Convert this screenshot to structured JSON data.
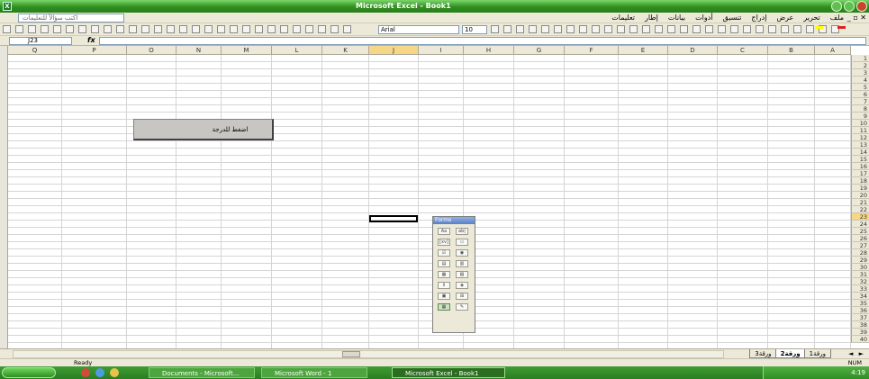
{
  "window": {
    "title": "Microsoft Excel - Book1"
  },
  "menubar": {
    "help_placeholder": "اكتب سؤالاً للتعليمات",
    "items": [
      "ملف",
      "تحرير",
      "عرض",
      "إدراج",
      "تنسيق",
      "أدوات",
      "بيانات",
      "إطار",
      "تعليمات"
    ]
  },
  "toolbar": {
    "font": "Arial",
    "size": "10"
  },
  "formula_bar": {
    "name_box": "J23",
    "fx": "fx",
    "formula": ""
  },
  "grid": {
    "column_headers": [
      "Q",
      "P",
      "O",
      "N",
      "M",
      "L",
      "K",
      "J",
      "I",
      "H",
      "G",
      "F",
      "E",
      "D",
      "C",
      "B",
      "A"
    ],
    "active_column": "J",
    "row_headers": [
      "1",
      "2",
      "3",
      "4",
      "5",
      "6",
      "7",
      "8",
      "9",
      "10",
      "11",
      "12",
      "13",
      "14",
      "15",
      "16",
      "17",
      "18",
      "19",
      "20",
      "21",
      "22",
      "23",
      "24",
      "25",
      "26",
      "27",
      "28",
      "29",
      "30",
      "31",
      "32",
      "33",
      "34",
      "35",
      "36",
      "37",
      "38",
      "39",
      "40"
    ],
    "active_row": "23"
  },
  "sheet_button": {
    "label": "اضغط للدرجة"
  },
  "forms_toolbar": {
    "title": "Forms",
    "tools": [
      "Aa",
      "ab|",
      "[xv]",
      "▭",
      "☑",
      "◉",
      "▤",
      "▥",
      "▦",
      "▧",
      "⇕",
      "◈",
      "▣",
      "⊞",
      "▦",
      "✎"
    ]
  },
  "sheet_tabs": {
    "tabs": [
      "ورقة1",
      "ورقة2",
      "ورقة3"
    ],
    "active_index": 1,
    "nav": "◄ ►"
  },
  "statusbar": {
    "ready": "Ready",
    "right": "NUM"
  },
  "taskbar": {
    "tasks": [
      "Documents - Microsoft...",
      "Microsoft Word - 1",
      "Microsoft Excel - Book1"
    ],
    "active_task": 2,
    "clock": "4:19"
  }
}
